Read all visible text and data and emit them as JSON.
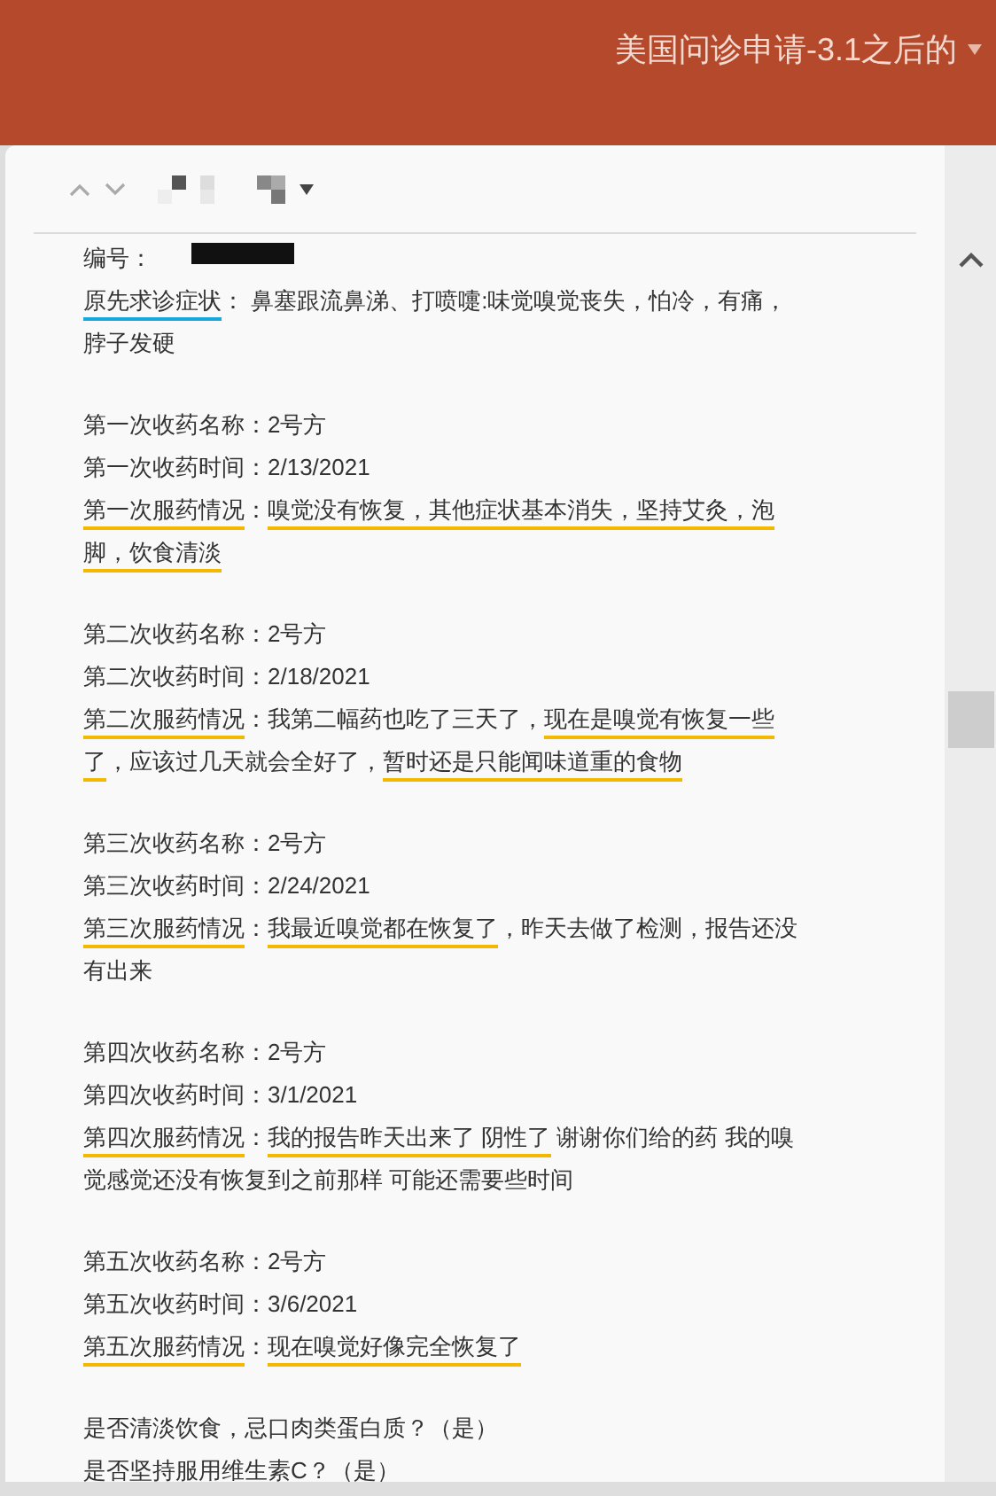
{
  "title": "美国问诊申请-3.1之后的",
  "groups": [
    {
      "lines": [
        {
          "redacted": true,
          "segments": [
            {
              "text": "编号："
            }
          ]
        },
        {
          "segments": [
            {
              "text": "原先求诊症状",
              "color": "#1aa7e0"
            },
            {
              "text": "： 鼻塞跟流鼻涕、打喷嚏:味觉嗅觉丧失，怕冷，有痛，脖子发硬"
            }
          ]
        }
      ]
    },
    {
      "lines": [
        {
          "segments": [
            {
              "text": "第一次收药名称：2号方"
            }
          ]
        },
        {
          "segments": [
            {
              "text": "第一次收药时间：2/13/2021"
            }
          ]
        },
        {
          "segments": [
            {
              "text": "第一次服药情况",
              "color": "#f5b800"
            },
            {
              "text": "："
            },
            {
              "text": "嗅觉没有恢复，其他症状基本消失，坚持艾灸，泡脚，饮食清淡",
              "color": "#f5b800"
            }
          ]
        }
      ]
    },
    {
      "lines": [
        {
          "segments": [
            {
              "text": "第二次收药名称：2号方"
            }
          ]
        },
        {
          "segments": [
            {
              "text": "第二次收药时间：2/18/2021"
            }
          ]
        },
        {
          "segments": [
            {
              "text": "第二次服药情况",
              "color": "#f5b800"
            },
            {
              "text": "：我第二幅药也吃了三天了，"
            },
            {
              "text": "现在是嗅觉有恢复一些了",
              "color": "#f5b800"
            },
            {
              "text": "，应该过几天就会全好了，"
            },
            {
              "text": "暂时还是只能闻味道重的食物",
              "color": "#f5b800"
            }
          ]
        }
      ]
    },
    {
      "lines": [
        {
          "segments": [
            {
              "text": "第三次收药名称：2号方"
            }
          ]
        },
        {
          "segments": [
            {
              "text": "第三次收药时间：2/24/2021"
            }
          ]
        },
        {
          "segments": [
            {
              "text": "第三次服药情况",
              "color": "#f5b800"
            },
            {
              "text": "："
            },
            {
              "text": "我最近嗅觉都在恢复了",
              "color": "#f5b800"
            },
            {
              "text": "，昨天去做了检测，报告还没有出来"
            }
          ]
        }
      ]
    },
    {
      "lines": [
        {
          "segments": [
            {
              "text": "第四次收药名称：2号方"
            }
          ]
        },
        {
          "segments": [
            {
              "text": "第四次收药时间：3/1/2021"
            }
          ]
        },
        {
          "segments": [
            {
              "text": "第四次服药情况",
              "color": "#f5b800"
            },
            {
              "text": "："
            },
            {
              "text": "我的报告昨天出来了 阴性了",
              "color": "#f5b800"
            },
            {
              "text": " 谢谢你们给的药 我的嗅觉感觉还没有恢复到之前那样 可能还需要些时间"
            }
          ]
        }
      ]
    },
    {
      "lines": [
        {
          "segments": [
            {
              "text": "第五次收药名称：2号方"
            }
          ]
        },
        {
          "segments": [
            {
              "text": "第五次收药时间：3/6/2021"
            }
          ]
        },
        {
          "segments": [
            {
              "text": "第五次服药情况",
              "color": "#f5b800"
            },
            {
              "text": "："
            },
            {
              "text": "现在嗅觉好像完全恢复了",
              "color": "#f5b800"
            }
          ]
        }
      ]
    },
    {
      "lines": [
        {
          "segments": [
            {
              "text": "是否清淡饮食，忌口肉类蛋白质？（是）"
            }
          ]
        },
        {
          "segments": [
            {
              "text": "是否坚持服用维生素C？（是）"
            }
          ]
        }
      ]
    }
  ]
}
